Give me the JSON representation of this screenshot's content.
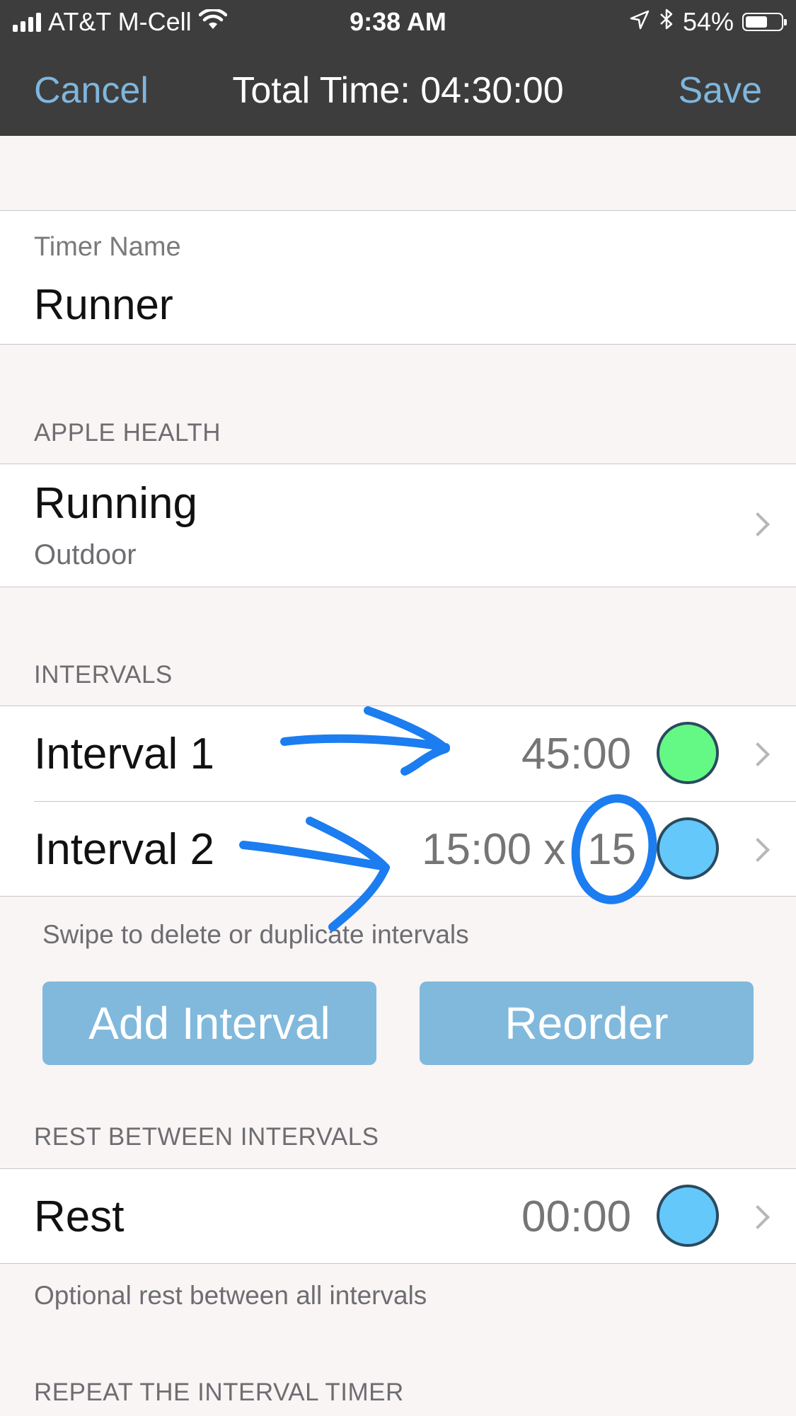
{
  "status_bar": {
    "carrier": "AT&T M-Cell",
    "time": "9:38 AM",
    "battery_percent": "54%",
    "icons": [
      "signal-icon",
      "wifi-icon",
      "location-icon",
      "bluetooth-icon",
      "battery-icon"
    ]
  },
  "nav": {
    "cancel_label": "Cancel",
    "title": "Total Time: 04:30:00",
    "save_label": "Save"
  },
  "timer_name": {
    "label": "Timer Name",
    "value": "Runner"
  },
  "apple_health": {
    "header": "APPLE HEALTH",
    "activity": "Running",
    "location": "Outdoor"
  },
  "intervals": {
    "header": "INTERVALS",
    "items": [
      {
        "name": "Interval 1",
        "duration": "45:00",
        "repeat": "",
        "color": "#64f984"
      },
      {
        "name": "Interval 2",
        "duration": "15:00 x",
        "repeat": "15",
        "color": "#64c8fb"
      }
    ],
    "footer": "Swipe to delete or duplicate intervals",
    "add_label": "Add Interval",
    "reorder_label": "Reorder"
  },
  "rest": {
    "header": "REST BETWEEN INTERVALS",
    "label": "Rest",
    "value": "00:00",
    "color": "#64c8fb",
    "footer": "Optional rest between all intervals"
  },
  "repeat": {
    "header": "REPEAT THE INTERVAL TIMER"
  }
}
